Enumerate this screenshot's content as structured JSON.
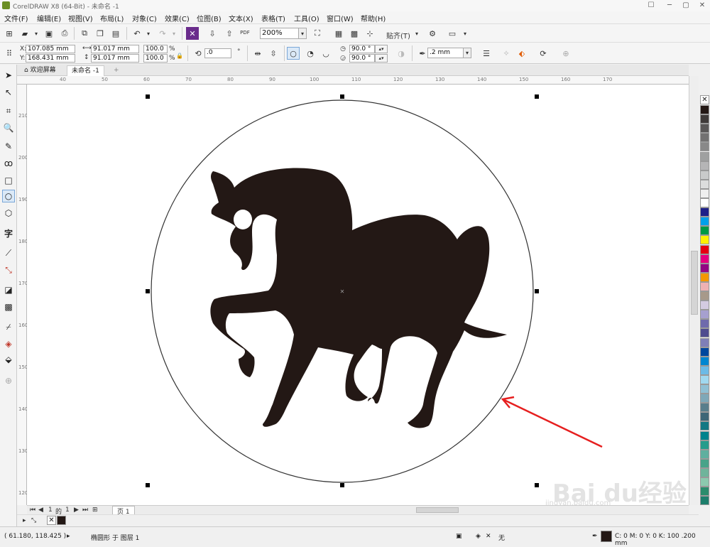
{
  "window": {
    "title": "CorelDRAW X8 (64-Bit) - 未命名 -1",
    "minimize": "─",
    "maximize": "▢",
    "close": "✕"
  },
  "menu": [
    "文件(F)",
    "编辑(E)",
    "视图(V)",
    "布局(L)",
    "对象(C)",
    "效果(C)",
    "位图(B)",
    "文本(X)",
    "表格(T)",
    "工具(O)",
    "窗口(W)",
    "帮助(H)"
  ],
  "toolbar": {
    "zoom": "200%",
    "snap_label": "贴齐(T)",
    "pdf_label": "PDF"
  },
  "property_bar": {
    "x_label": "X:",
    "x_value": "107.085 mm",
    "y_label": "Y:",
    "y_value": "168.431 mm",
    "width_value": "91.017 mm",
    "height_value": "91.017 mm",
    "scale_w": "100.0",
    "scale_h": "100.0",
    "percent": "%",
    "rotation": ".0",
    "angle1": "90.0 °",
    "angle2": "90.0 °",
    "outline": ".2 mm"
  },
  "tabs": {
    "welcome": "欢迎屏幕",
    "doc": "未命名 -1",
    "add": "+"
  },
  "ruler": {
    "h_ticks": [
      "40",
      "50",
      "60",
      "70",
      "80",
      "90",
      "100",
      "110",
      "120",
      "130",
      "140",
      "150",
      "160",
      "170"
    ],
    "v_ticks": [
      "210",
      "200",
      "190",
      "180",
      "170",
      "160",
      "150",
      "140",
      "130",
      "120"
    ]
  },
  "page_nav": {
    "current": "1",
    "of": "的",
    "total": "1",
    "page_tab": "页 1"
  },
  "status": {
    "coords": "( 61.180, 118.425 )",
    "object_info": "椭圆形 于 图层 1",
    "fill_none": "无",
    "outline_info": "C: 0 M: 0 Y: 0 K: 100  .200 mm"
  },
  "palette_colors": [
    "#231815",
    "#3e3a39",
    "#595757",
    "#727171",
    "#898989",
    "#9fa0a0",
    "#b5b5b6",
    "#c9caca",
    "#dcdddd",
    "#efefef",
    "#ffffff",
    "#1d2088",
    "#00a0e9",
    "#009944",
    "#fff100",
    "#e60012",
    "#e4007f",
    "#920783",
    "#f39800",
    "#eeb1b3",
    "#a7998a",
    "#d3cbe1",
    "#a6a0cf",
    "#6f6aac",
    "#4f4c8f",
    "#7f7fb7",
    "#00479d",
    "#0086d1",
    "#6cbae6",
    "#a0d8ef",
    "#8fc0d4",
    "#7ea8b8",
    "#597e8c",
    "#3e6677",
    "#137883",
    "#00838d",
    "#269c8c",
    "#5faf9f",
    "#48a389",
    "#6fb49b",
    "#8cc9ae",
    "#2b8c6c",
    "#1d7e6c"
  ],
  "colors": {
    "horse": "#231815",
    "accent_arrow": "#e61f1f"
  },
  "watermark": {
    "brand": "Bai du",
    "chinese": "经验",
    "url": "jingyan.baidu.com"
  }
}
